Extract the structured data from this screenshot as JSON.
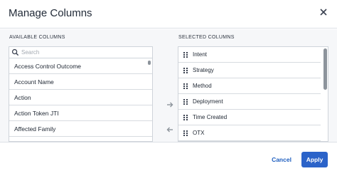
{
  "dialog": {
    "title": "Manage Columns",
    "close_icon": "close-icon"
  },
  "available": {
    "label": "AVAILABLE COLUMNS",
    "search_placeholder": "Search",
    "items": [
      {
        "label": "Access Control Outcome"
      },
      {
        "label": "Account Name"
      },
      {
        "label": "Action"
      },
      {
        "label": "Action Token JTI"
      },
      {
        "label": "Affected Family"
      }
    ]
  },
  "selected": {
    "label": "SELECTED COLUMNS",
    "items": [
      {
        "label": "Intent"
      },
      {
        "label": "Strategy"
      },
      {
        "label": "Method"
      },
      {
        "label": "Deployment"
      },
      {
        "label": "Time Created"
      },
      {
        "label": "OTX"
      }
    ]
  },
  "transfer": {
    "add_icon": "arrow-right-icon",
    "remove_icon": "arrow-left-icon"
  },
  "footer": {
    "cancel_label": "Cancel",
    "apply_label": "Apply"
  },
  "colors": {
    "accent": "#2b63c9",
    "link": "#1f5fc0",
    "body_bg": "#f6f7f9",
    "border": "#cfd4da"
  }
}
